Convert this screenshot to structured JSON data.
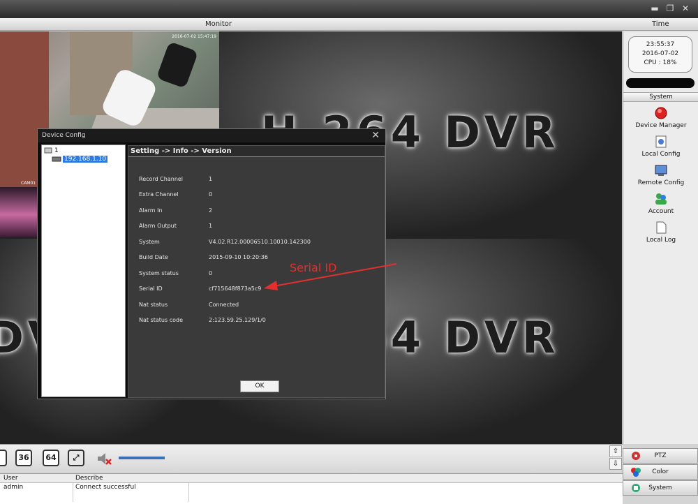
{
  "header": {
    "monitor_label": "Monitor",
    "time_label": "Time"
  },
  "video": {
    "dvr_text": "H.264 DVR",
    "camera_label": "CAM01",
    "camera_timestamp": "2016-07-02 15:47:19"
  },
  "clock": {
    "time": "23:55:37",
    "date": "2016-07-02",
    "cpu": "CPU : 18%"
  },
  "system_panel": {
    "header": "System",
    "items": [
      {
        "label": "Device Manager",
        "icon": "device-manager-icon"
      },
      {
        "label": "Local Config",
        "icon": "local-config-icon"
      },
      {
        "label": "Remote Config",
        "icon": "remote-config-icon"
      },
      {
        "label": "Account",
        "icon": "account-icon"
      },
      {
        "label": "Local Log",
        "icon": "local-log-icon"
      }
    ]
  },
  "toolbar": {
    "btn_36": "36",
    "btn_64": "64"
  },
  "log": {
    "columns": [
      "User",
      "Describe"
    ],
    "rows": [
      {
        "user": "admin",
        "describe": "Connect successful"
      }
    ]
  },
  "bottom_buttons": {
    "ptz": "PTZ",
    "color": "Color",
    "system": "System"
  },
  "dialog": {
    "title": "Device Config",
    "tree_root": "1",
    "tree_device": "192.168.1.10",
    "breadcrumb": "Setting -> Info -> Version",
    "fields": [
      {
        "key": "Record Channel",
        "value": "1"
      },
      {
        "key": "Extra Channel",
        "value": "0"
      },
      {
        "key": "Alarm In",
        "value": "2"
      },
      {
        "key": "Alarm Output",
        "value": "1"
      },
      {
        "key": "System",
        "value": "V4.02.R12.00006510.10010.142300"
      },
      {
        "key": "Build Date",
        "value": "2015-09-10 10:20:36"
      },
      {
        "key": "System status",
        "value": "0"
      },
      {
        "key": "Serial ID",
        "value": "cf715648f873a5c9"
      },
      {
        "key": "Nat status",
        "value": "Connected"
      },
      {
        "key": "Nat status code",
        "value": "2:123.59.25.129/1/0"
      }
    ],
    "ok_label": "OK"
  },
  "annotation": {
    "text": "Serial ID",
    "color": "#e3302f"
  }
}
